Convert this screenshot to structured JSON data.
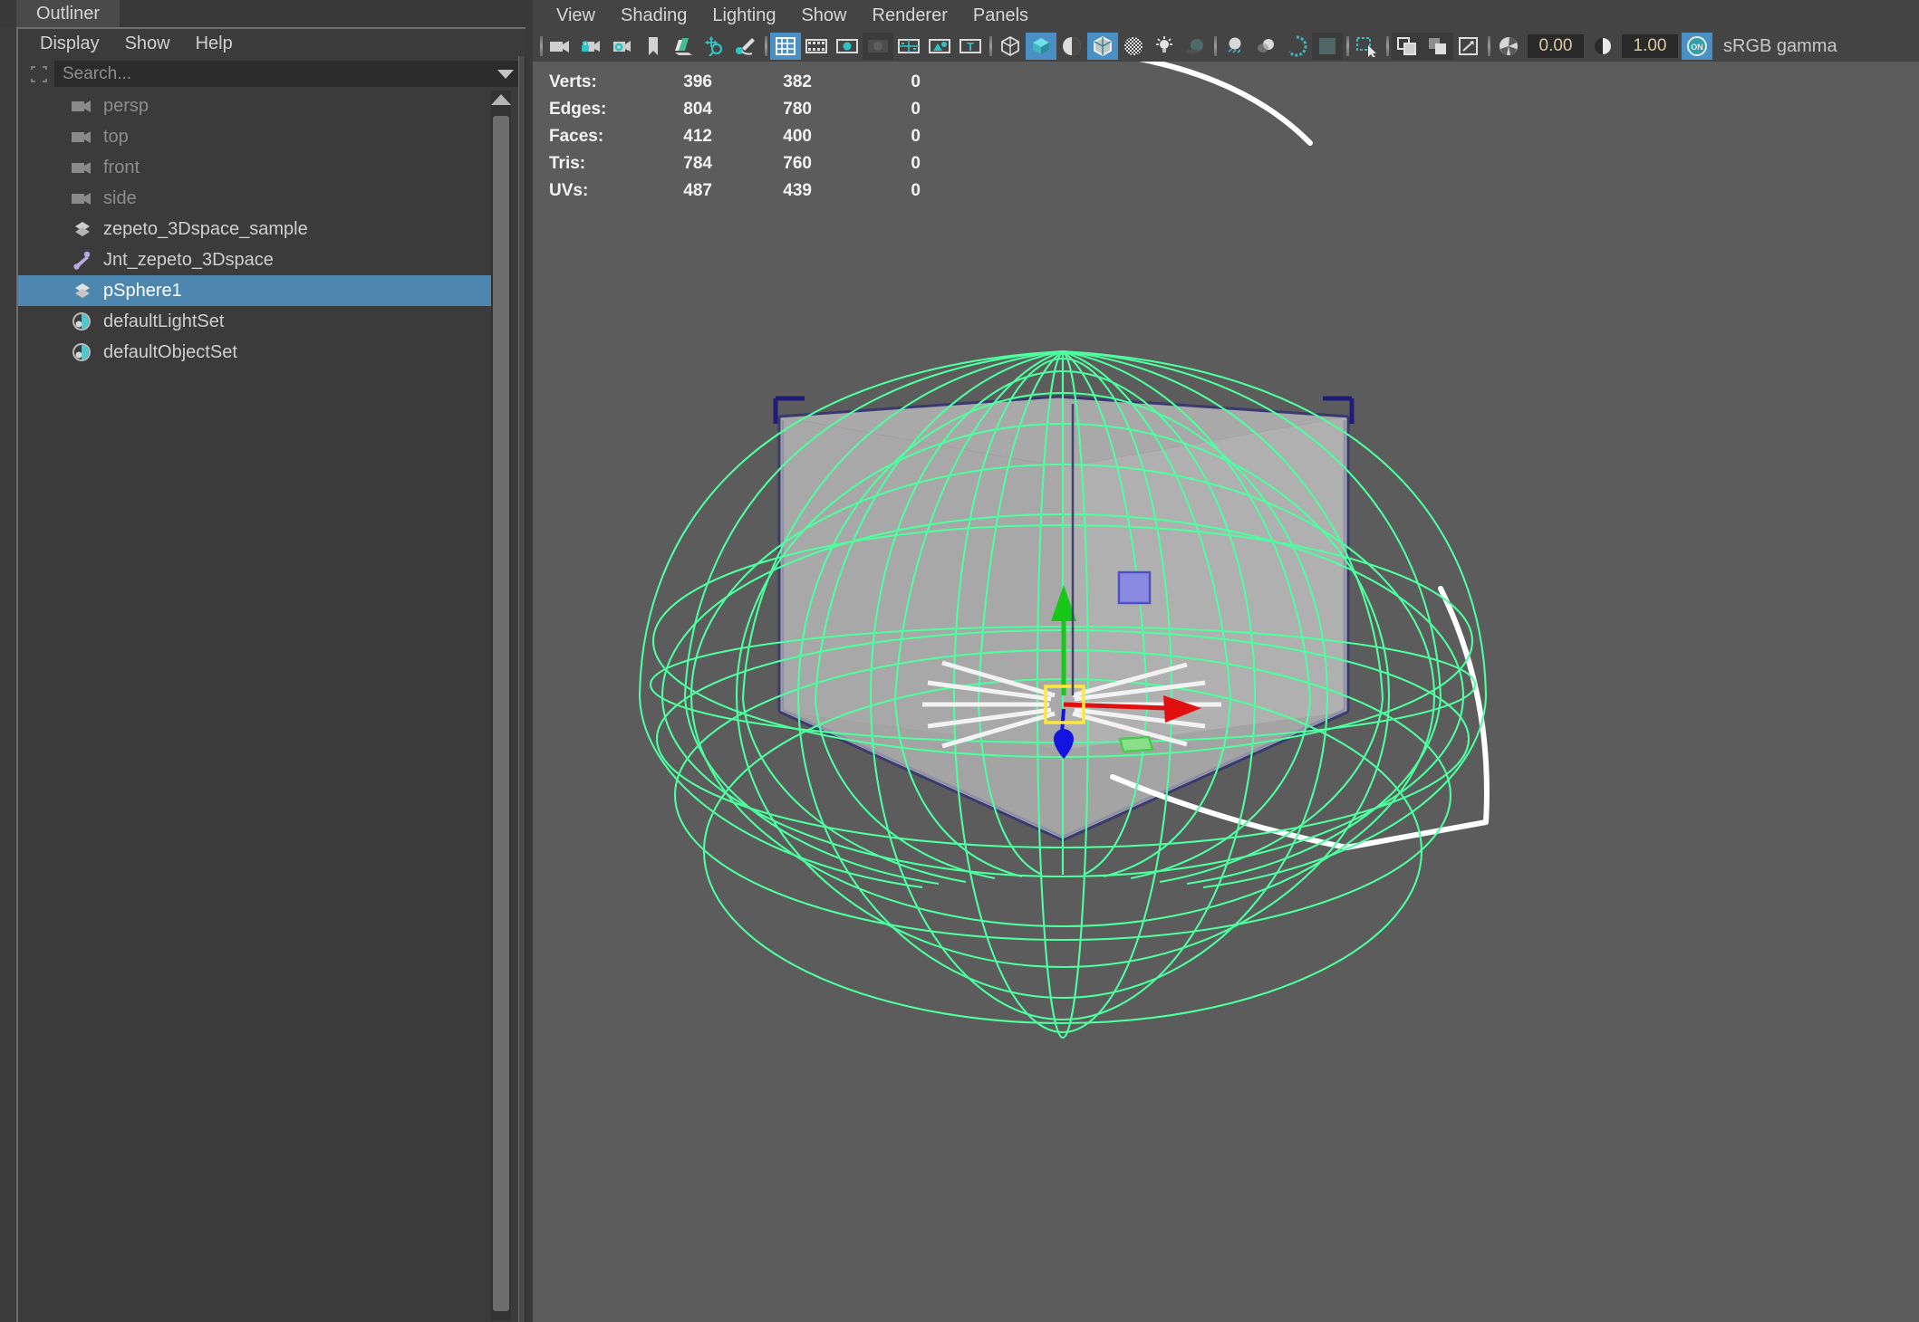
{
  "outliner": {
    "tab_label": "Outliner",
    "menus": [
      "Display",
      "Show",
      "Help"
    ],
    "search": {
      "placeholder": "Search...",
      "value": ""
    },
    "items": [
      {
        "label": "persp",
        "icon": "camera-icon",
        "state": "dim"
      },
      {
        "label": "top",
        "icon": "camera-icon",
        "state": "dim"
      },
      {
        "label": "front",
        "icon": "camera-icon",
        "state": "dim"
      },
      {
        "label": "side",
        "icon": "camera-icon",
        "state": "dim"
      },
      {
        "label": "zepeto_3Dspace_sample",
        "icon": "mesh-icon",
        "state": "normal"
      },
      {
        "label": "Jnt_zepeto_3Dspace",
        "icon": "joint-icon",
        "state": "normal"
      },
      {
        "label": "pSphere1",
        "icon": "mesh-icon",
        "state": "selected"
      },
      {
        "label": "defaultLightSet",
        "icon": "set-icon",
        "state": "normal"
      },
      {
        "label": "defaultObjectSet",
        "icon": "set-icon",
        "state": "normal"
      }
    ]
  },
  "viewport": {
    "menus": [
      "View",
      "Shading",
      "Lighting",
      "Show",
      "Renderer",
      "Panels"
    ],
    "toolbar": {
      "icons": [
        "sep",
        "camera-icon",
        "camera-lock-icon",
        "camera-settings-icon",
        "bookmark-icon",
        "image-plane-icon",
        "move-pivot-icon",
        "paint-icon",
        "sep",
        "grid-icon",
        "film-gate-icon",
        "resolution-gate-icon",
        "gate-mask-icon",
        "field-chart-icon",
        "safe-action-icon",
        "safe-title-icon",
        "sep",
        "wireframe-cube-icon",
        "smooth-shade-cube-icon",
        "shade-sphere-icon",
        "wireframe-on-shaded-icon",
        "texture-checker-icon",
        "light-bulb-icon",
        "shadow-icon",
        "sep",
        "ao-icon",
        "motion-blur-icon",
        "aa-icon",
        "viewport-bg-icon",
        "sep",
        "xray-select-icon",
        "sep",
        "isolate-select-icon",
        "no-isolate-icon",
        "snapshot-icon",
        "sep",
        "exposure-icon"
      ],
      "exposure_value": "0.00",
      "gamma_value": "1.00",
      "color_toggle": "ON",
      "color_profile": "sRGB gamma"
    },
    "hud": {
      "columns": [
        "label",
        "total",
        "visible",
        "selected"
      ],
      "rows": [
        {
          "label": "Verts:",
          "total": "396",
          "visible": "382",
          "selected": "0"
        },
        {
          "label": "Edges:",
          "total": "804",
          "visible": "780",
          "selected": "0"
        },
        {
          "label": "Faces:",
          "total": "412",
          "visible": "400",
          "selected": "0"
        },
        {
          "label": "Tris:",
          "total": "784",
          "visible": "760",
          "selected": "0"
        },
        {
          "label": "UVs:",
          "total": "487",
          "visible": "439",
          "selected": "0"
        }
      ]
    },
    "manipulator": {
      "type": "move-manipulator",
      "axis_x_color": "#e81414",
      "axis_y_color": "#1ec81e",
      "axis_z_color": "#1414e8",
      "center_color": "#ffe84a"
    },
    "colors": {
      "background": "#5c5c5c",
      "selected_wireframe": "#4dff9e",
      "shaded_surface": "#a8a8a8",
      "bbox_outline": "#2a2a7a",
      "curve_highlight": "#ffffff"
    }
  }
}
